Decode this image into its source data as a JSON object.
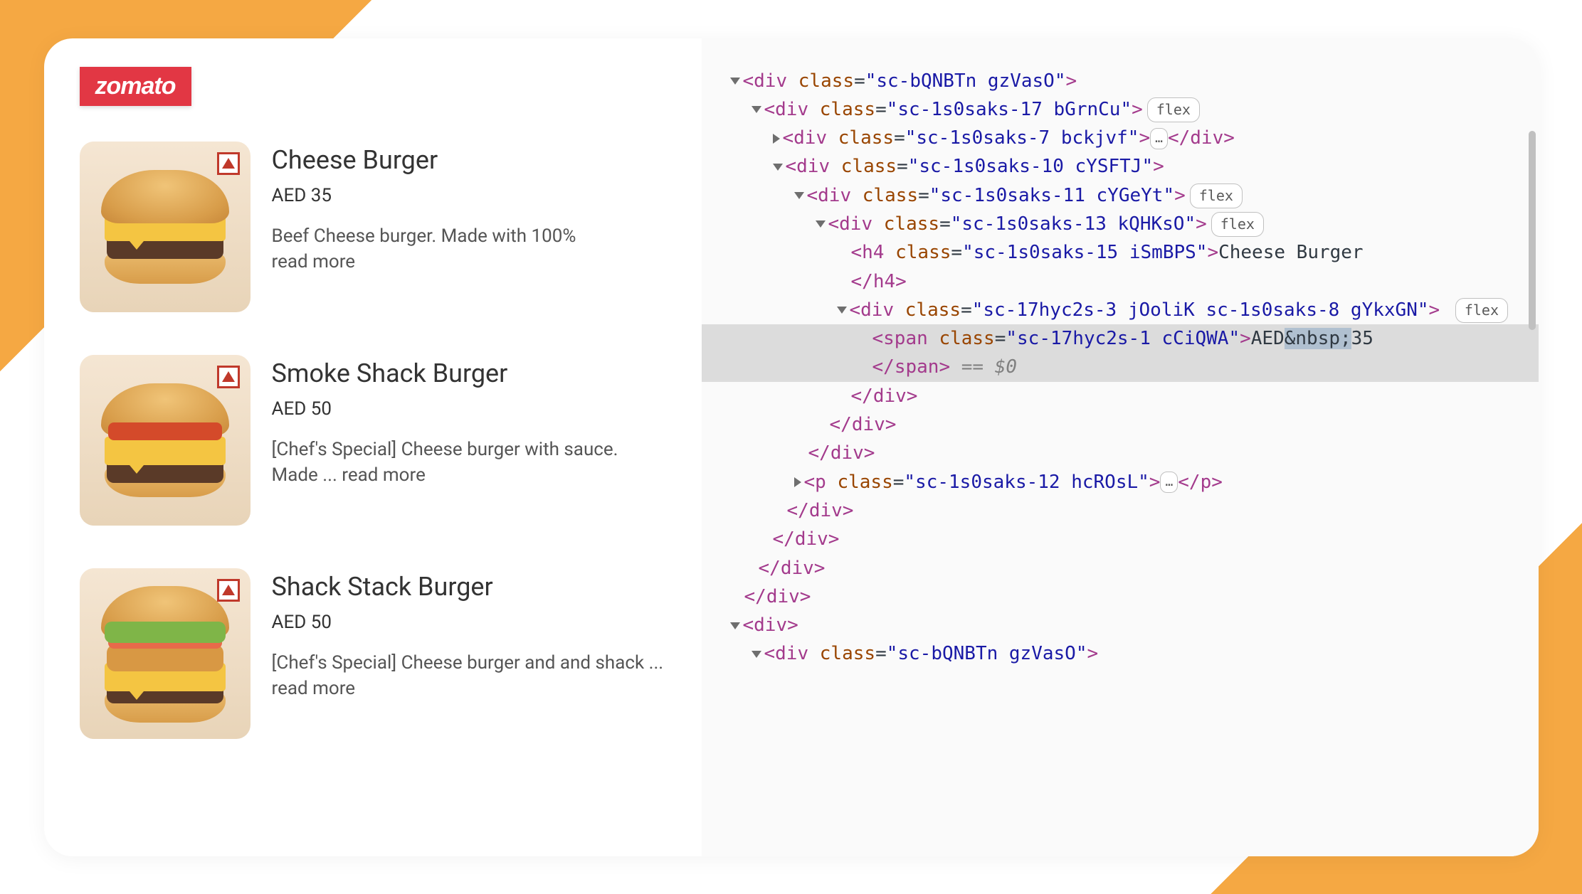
{
  "logo": "zomato",
  "menu": [
    {
      "title": "Cheese Burger",
      "price": "AED 35",
      "desc": "Beef Cheese burger. Made with 100%",
      "read_more": "read more"
    },
    {
      "title": "Smoke Shack Burger",
      "price": "AED 50",
      "desc": "[Chef's Special] Cheese burger with sauce. Made ... ",
      "read_more": "read more"
    },
    {
      "title": "Shack Stack Burger",
      "price": "AED 50",
      "desc": "[Chef's Special] Cheese burger and and shack ... ",
      "read_more": "read more"
    }
  ],
  "dom": {
    "l1": "<div class=\"sc-bQNBTn gzVasO\">",
    "l2": "<div class=\"sc-1s0saks-17 bGrnCu\">",
    "l2_pill": "flex",
    "l3": "<div class=\"sc-1s0saks-7 bckjvf\">",
    "l3_ell": "…",
    "l3_close": "</div>",
    "l4": "<div class=\"sc-1s0saks-10 cYSFTJ\">",
    "l5": "<div class=\"sc-1s0saks-11 cYGeYt\">",
    "l5_pill": "flex",
    "l6": "<div class=\"sc-1s0saks-13 kQHKsO\">",
    "l6_pill": "flex",
    "l7_open": "<h4 class=\"sc-1s0saks-15 iSmBPS\">",
    "l7_text": "Cheese Burger",
    "l7_close": "</h4>",
    "l8": "<div class=\"sc-17hyc2s-3 jOoliK sc-1s0saks-8 gYkxGN\">",
    "l8_pill": "flex",
    "l9_open": "<span class=\"sc-17hyc2s-1 cCiQWA\">",
    "l9_text_a": "AED",
    "l9_text_b": "&nbsp;",
    "l9_text_c": "35",
    "l9_close": "</span>",
    "l9_eq": " == $0",
    "c1": "</div>",
    "c2": "</div>",
    "c3": "</div>",
    "l10": "<p class=\"sc-1s0saks-12 hcROsL\">",
    "l10_ell": "…",
    "l10_close": "</p>",
    "c4": "</div>",
    "c5": "</div>",
    "c6": "</div>",
    "c7": "</div>",
    "l11": "<div>",
    "l12": "<div class=\"sc-bQNBTn gzVasO\">"
  }
}
